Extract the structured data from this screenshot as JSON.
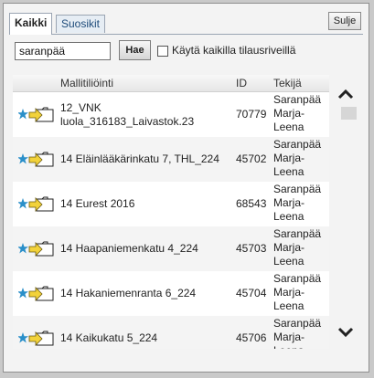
{
  "tabs": [
    {
      "label": "Kaikki",
      "active": true
    },
    {
      "label": "Suosikit",
      "active": false
    }
  ],
  "close_label": "Sulje",
  "search": {
    "value": "saranpää",
    "button_label": "Hae"
  },
  "filter": {
    "label": "Käytä kaikilla tilausriveillä",
    "checked": false
  },
  "columns": {
    "name": "Mallitiliöinti",
    "id": "ID",
    "author": "Tekijä"
  },
  "rows": [
    {
      "name_line1": "12_VNK",
      "name_line2": "luola_316183_Laivastok.23",
      "id": "70779",
      "author": [
        "Saranpää",
        "Marja-",
        "Leena"
      ]
    },
    {
      "name_line1": "14 Eläinlääkärinkatu 7, THL_224",
      "name_line2": "",
      "id": "45702",
      "author": [
        "Saranpää",
        "Marja-",
        "Leena"
      ]
    },
    {
      "name_line1": "14 Eurest 2016",
      "name_line2": "",
      "id": "68543",
      "author": [
        "Saranpää",
        "Marja-",
        "Leena"
      ]
    },
    {
      "name_line1": "14 Haapaniemenkatu 4_224",
      "name_line2": "",
      "id": "45703",
      "author": [
        "Saranpää",
        "Marja-",
        "Leena"
      ]
    },
    {
      "name_line1": "14 Hakaniemenranta 6_224",
      "name_line2": "",
      "id": "45704",
      "author": [
        "Saranpää",
        "Marja-",
        "Leena"
      ]
    },
    {
      "name_line1": "14 Kaikukatu 5_224",
      "name_line2": "",
      "id": "45706",
      "author": [
        "Saranpää",
        "Marja-",
        "Leena"
      ]
    }
  ],
  "icons": {
    "favorite": "star-icon",
    "select": "arrow-folder-icon",
    "scroll_up": "chevron-up-icon",
    "scroll_down": "chevron-down-icon"
  },
  "colors": {
    "star": "#2a8fc9",
    "arrow": "#f2d23a",
    "folder": "#fff"
  }
}
